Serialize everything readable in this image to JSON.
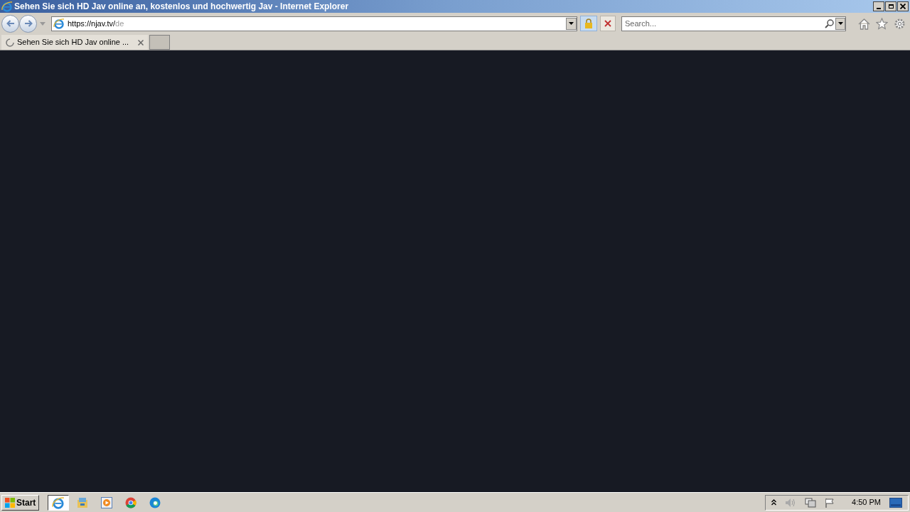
{
  "window": {
    "title": "Sehen Sie sich HD Jav online an, kostenlos und hochwertig Jav - Internet Explorer"
  },
  "address_bar": {
    "url_host": "https://njav.tv/",
    "url_path": "de"
  },
  "search": {
    "placeholder": "Search..."
  },
  "tabs": [
    {
      "label": "Sehen Sie sich HD Jav online ...",
      "selected": true,
      "loading": true
    }
  ],
  "taskbar": {
    "start": "Start",
    "apps": [
      {
        "kind": "ie",
        "selected": true
      },
      {
        "kind": "explorer",
        "selected": false
      },
      {
        "kind": "media",
        "selected": false
      },
      {
        "kind": "chrome",
        "selected": false
      },
      {
        "kind": "edge",
        "selected": false
      }
    ],
    "clock": "4:50 PM"
  }
}
